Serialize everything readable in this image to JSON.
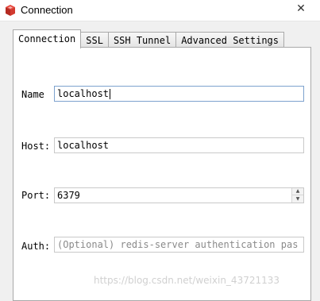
{
  "window": {
    "title": "Connection",
    "close_glyph": "✕",
    "app_icon": "redis-icon"
  },
  "tabs": [
    {
      "label": "Connection",
      "active": true
    },
    {
      "label": "SSL",
      "active": false
    },
    {
      "label": "SSH Tunnel",
      "active": false
    },
    {
      "label": "Advanced Settings",
      "active": false
    }
  ],
  "form": {
    "name": {
      "label": "Name",
      "value": "localhost"
    },
    "host": {
      "label": "Host:",
      "value": "localhost"
    },
    "port": {
      "label": "Port:",
      "value": "6379"
    },
    "auth": {
      "label": "Auth:",
      "placeholder": "(Optional) redis-server authentication pas"
    }
  },
  "watermark": "https://blog.csdn.net/weixin_43721133"
}
